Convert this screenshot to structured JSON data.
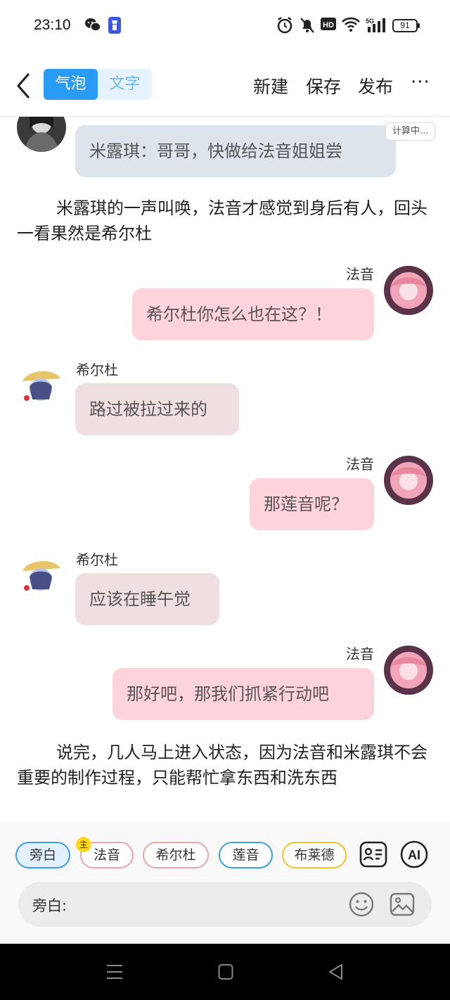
{
  "status": {
    "time": "23:10",
    "battery": "91",
    "network": "5G"
  },
  "header": {
    "mode_bubble": "气泡",
    "mode_text": "文字",
    "new_label": "新建",
    "save_label": "保存",
    "publish_label": "发布",
    "more_label": "···"
  },
  "chat": {
    "calc_badge": "计算中...",
    "messages": [
      {
        "speaker": "",
        "text": "米露琪：哥哥，快做给法音姐姐尝"
      },
      {
        "narration": "米露琪的一声叫唤，法音才感觉到身后有人，回头一看果然是希尔杜"
      },
      {
        "speaker": "法音",
        "text": "希尔杜你怎么也在这？！"
      },
      {
        "speaker": "希尔杜",
        "text": "路过被拉过来的"
      },
      {
        "speaker": "法音",
        "text": "那莲音呢？"
      },
      {
        "speaker": "希尔杜",
        "text": "应该在睡午觉"
      },
      {
        "speaker": "法音",
        "text": "那好吧，那我们抓紧行动吧"
      },
      {
        "narration": "说完，几人马上进入状态，因为法音和米露琪不会重要的制作过程，只能帮忙拿东西和洗东西"
      }
    ]
  },
  "bottom": {
    "chips": [
      "旁白",
      "法音",
      "希尔杜",
      "莲音",
      "布莱德"
    ],
    "main_badge": "主",
    "ai_label": "AI",
    "input_label": "旁白:",
    "input_value": ""
  },
  "colors": {
    "accent": "#2a9cf5",
    "bubble_right": "#ffd3dc",
    "bubble_left": "#efdfe0",
    "bubble_gray": "#dde4ec"
  },
  "icons": [
    "wechat-icon",
    "flashlight-icon",
    "alarm-icon",
    "mute-icon",
    "hd-icon",
    "wifi-icon",
    "signal-icon",
    "back-icon",
    "contact-card-icon",
    "smiley-icon",
    "image-icon",
    "menu-icon",
    "home-icon",
    "back-triangle-icon"
  ]
}
